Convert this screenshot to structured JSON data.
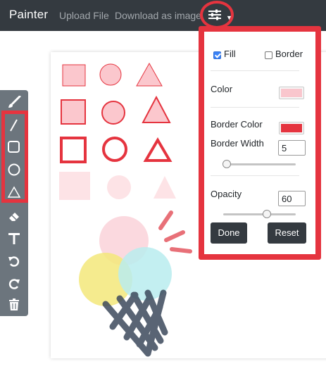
{
  "navbar": {
    "brand": "Painter",
    "links": [
      "Upload File",
      "Download as image"
    ]
  },
  "toolbar": {
    "tools": [
      "brush-icon",
      "line-icon",
      "rectangle-icon",
      "circle-icon",
      "triangle-icon",
      "eraser-icon",
      "text-icon",
      "undo-icon",
      "redo-icon",
      "trash-icon"
    ]
  },
  "settings": {
    "fill_label": "Fill",
    "fill_checked": true,
    "border_label": "Border",
    "border_checked": false,
    "color_label": "Color",
    "fill_color": "#f9c6cd",
    "border_color_label": "Border Color",
    "border_color": "#e5343f",
    "border_width_label": "Border Width",
    "border_width": "5",
    "border_width_slider": 0.05,
    "opacity_label": "Opacity",
    "opacity": "60",
    "opacity_slider": 0.6,
    "done_label": "Done",
    "reset_label": "Reset"
  },
  "colors": {
    "navbar": "#343a40",
    "toolbar": "#6c757d",
    "highlight": "#e5343f",
    "shape_fill": "#fbc7cd",
    "shape_stroke": "#e5343f",
    "yellow_scoop": "#f3e87a",
    "cyan_scoop": "#b9ecef",
    "cone": "#3d4a5c"
  }
}
